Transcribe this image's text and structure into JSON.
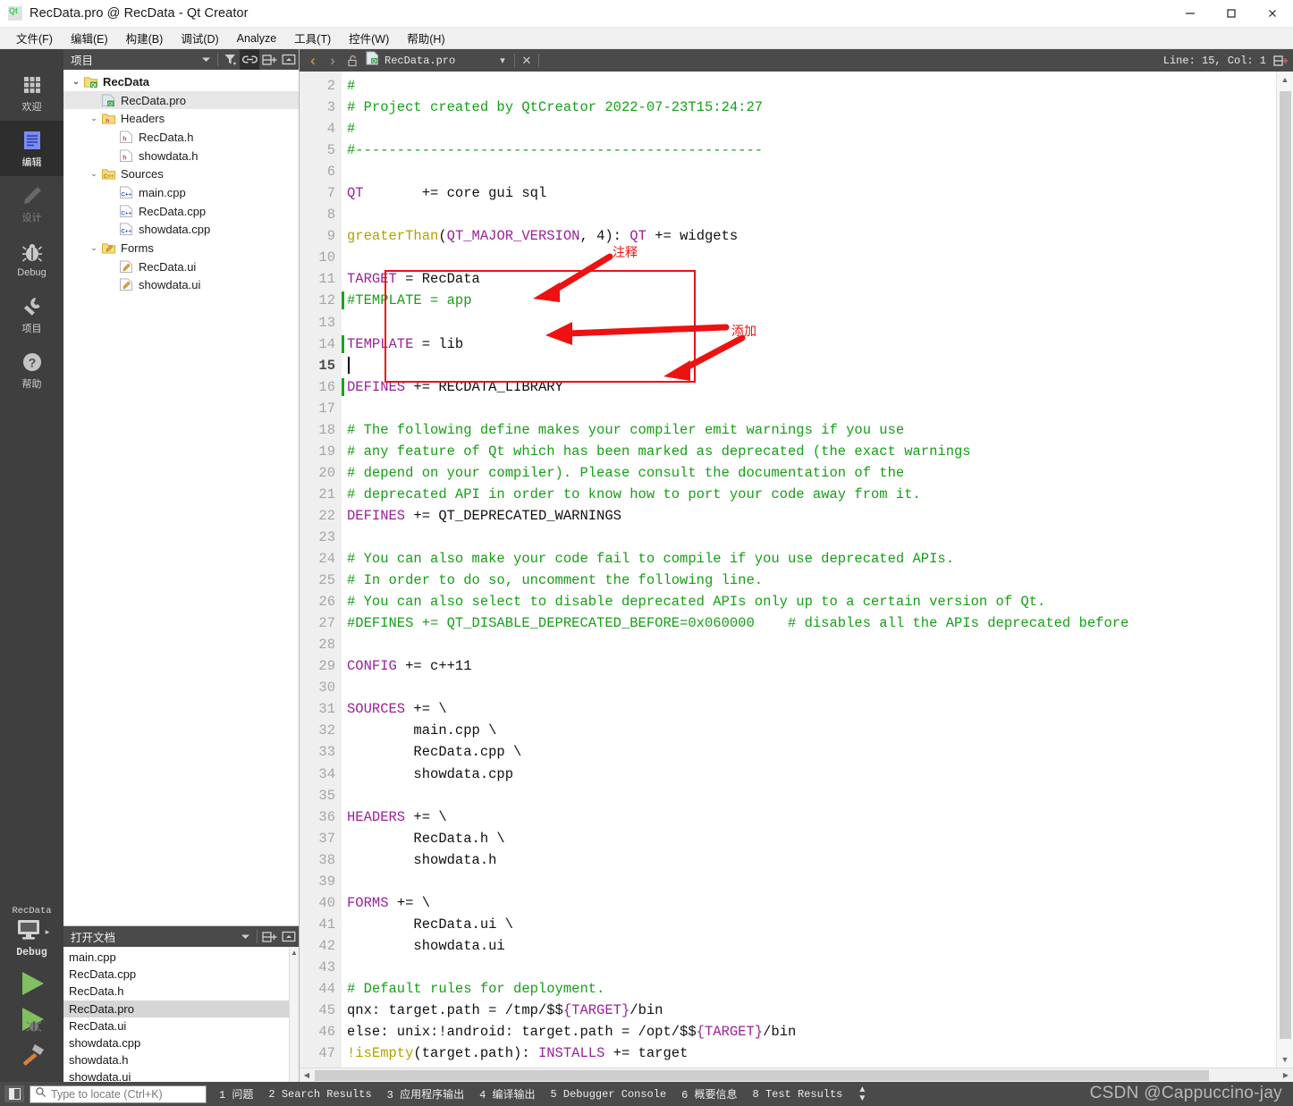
{
  "window": {
    "title": "RecData.pro @ RecData - Qt Creator",
    "app_icon": "qt-logo-icon",
    "minimize": "—",
    "maximize": "□",
    "close": "✕"
  },
  "menubar": {
    "items": [
      {
        "label": "文件(F)",
        "name": "menu-file"
      },
      {
        "label": "编辑(E)",
        "name": "menu-edit"
      },
      {
        "label": "构建(B)",
        "name": "menu-build"
      },
      {
        "label": "调试(D)",
        "name": "menu-debug"
      },
      {
        "label": "Analyze",
        "name": "menu-analyze"
      },
      {
        "label": "工具(T)",
        "name": "menu-tools"
      },
      {
        "label": "控件(W)",
        "name": "menu-window"
      },
      {
        "label": "帮助(H)",
        "name": "menu-help"
      }
    ]
  },
  "modebar": {
    "items": [
      {
        "label": "欢迎",
        "icon": "grid-icon",
        "active": false,
        "disabled": false
      },
      {
        "label": "编辑",
        "icon": "document-lines-icon",
        "active": true,
        "disabled": false
      },
      {
        "label": "设计",
        "icon": "pencil-icon",
        "active": false,
        "disabled": true
      },
      {
        "label": "Debug",
        "icon": "bug-icon",
        "active": false,
        "disabled": false
      },
      {
        "label": "项目",
        "icon": "wrench-icon",
        "active": false,
        "disabled": false
      },
      {
        "label": "帮助",
        "icon": "question-circle-icon",
        "active": false,
        "disabled": false
      }
    ],
    "kit": {
      "project": "RecData",
      "build_config": "Debug",
      "monitor_icon": "monitor-icon",
      "expand_arrow": "▸"
    },
    "run_buttons": [
      {
        "name": "run-button",
        "icon": "play-triangle-icon"
      },
      {
        "name": "start-debugging-button",
        "icon": "play-bug-icon"
      },
      {
        "name": "build-button",
        "icon": "hammer-icon"
      }
    ]
  },
  "project_panel": {
    "title": "项目",
    "tools": [
      {
        "name": "projects-dropdown-icon",
        "glyph": "▾"
      },
      {
        "name": "filter-icon",
        "glyph": "filter"
      },
      {
        "name": "sync-with-editor-icon",
        "glyph": "link",
        "active": true
      },
      {
        "name": "split-icon",
        "glyph": "split"
      },
      {
        "name": "collapse-panel-icon",
        "glyph": "collapse"
      }
    ],
    "tree": [
      {
        "label": "RecData",
        "depth": 0,
        "chevron": "⌄",
        "icon": "qt-project-icon",
        "bold": true,
        "selected": false
      },
      {
        "label": "RecData.pro",
        "depth": 1,
        "chevron": "",
        "icon": "pro-file-icon",
        "bold": false,
        "selected": true
      },
      {
        "label": "Headers",
        "depth": 1,
        "chevron": "⌄",
        "icon": "headers-folder-icon",
        "bold": false,
        "selected": false
      },
      {
        "label": "RecData.h",
        "depth": 2,
        "chevron": "",
        "icon": "h-file-icon",
        "bold": false,
        "selected": false
      },
      {
        "label": "showdata.h",
        "depth": 2,
        "chevron": "",
        "icon": "h-file-icon",
        "bold": false,
        "selected": false
      },
      {
        "label": "Sources",
        "depth": 1,
        "chevron": "⌄",
        "icon": "sources-folder-icon",
        "bold": false,
        "selected": false
      },
      {
        "label": "main.cpp",
        "depth": 2,
        "chevron": "",
        "icon": "cpp-file-icon",
        "bold": false,
        "selected": false
      },
      {
        "label": "RecData.cpp",
        "depth": 2,
        "chevron": "",
        "icon": "cpp-file-icon",
        "bold": false,
        "selected": false
      },
      {
        "label": "showdata.cpp",
        "depth": 2,
        "chevron": "",
        "icon": "cpp-file-icon",
        "bold": false,
        "selected": false
      },
      {
        "label": "Forms",
        "depth": 1,
        "chevron": "⌄",
        "icon": "forms-folder-icon",
        "bold": false,
        "selected": false
      },
      {
        "label": "RecData.ui",
        "depth": 2,
        "chevron": "",
        "icon": "ui-file-icon",
        "bold": false,
        "selected": false
      },
      {
        "label": "showdata.ui",
        "depth": 2,
        "chevron": "",
        "icon": "ui-file-icon",
        "bold": false,
        "selected": false
      }
    ]
  },
  "open_documents": {
    "title": "打开文档",
    "tools": [
      {
        "name": "opendocs-dropdown-icon",
        "glyph": "▾"
      },
      {
        "name": "split-icon",
        "glyph": "split"
      },
      {
        "name": "collapse-panel-icon",
        "glyph": "collapse"
      }
    ],
    "items": [
      {
        "label": "main.cpp",
        "selected": false
      },
      {
        "label": "RecData.cpp",
        "selected": false
      },
      {
        "label": "RecData.h",
        "selected": false
      },
      {
        "label": "RecData.pro",
        "selected": true
      },
      {
        "label": "RecData.ui",
        "selected": false
      },
      {
        "label": "showdata.cpp",
        "selected": false
      },
      {
        "label": "showdata.h",
        "selected": false
      },
      {
        "label": "showdata.ui",
        "selected": false
      }
    ]
  },
  "editor": {
    "nav_back": "‹",
    "nav_forward": "›",
    "lock_icon": "unlocked-icon",
    "tab_name": "RecData.pro",
    "tab_icon": "pro-file-icon",
    "tab_dropdown": "▾",
    "tab_close": "✕",
    "line_col": "Line: 15, Col: 1",
    "split_icon": "split-editor-icon",
    "first_line_number": 2,
    "cursor_line": 15,
    "lines": [
      {
        "n": 2,
        "text": "#",
        "cls": "cmt"
      },
      {
        "n": 3,
        "text": "# Project created by QtCreator 2022-07-23T15:24:27",
        "cls": "cmt"
      },
      {
        "n": 4,
        "text": "#",
        "cls": "cmt"
      },
      {
        "n": 5,
        "text": "#-------------------------------------------------",
        "cls": "cmt"
      },
      {
        "n": 6,
        "text": "",
        "cls": ""
      },
      {
        "n": 7,
        "html": "<span class='kw'>QT</span>       += core gui sql"
      },
      {
        "n": 8,
        "text": "",
        "cls": ""
      },
      {
        "n": 9,
        "html": "<span class='fn'>greaterThan</span>(<span class='kw'>QT_MAJOR_VERSION</span>, 4): <span class='kw'>QT</span> += widgets"
      },
      {
        "n": 10,
        "text": "",
        "cls": ""
      },
      {
        "n": 11,
        "html": "<span class='kw'>TARGET</span> = RecData"
      },
      {
        "n": 12,
        "html": "<span class='cmt'>#TEMPLATE = app</span>",
        "changed": true
      },
      {
        "n": 13,
        "text": "",
        "cls": ""
      },
      {
        "n": 14,
        "html": "<span class='kw'>TEMPLATE</span> = lib",
        "changed": true
      },
      {
        "n": 15,
        "text": "",
        "cls": "",
        "changed": false,
        "cursor": true
      },
      {
        "n": 16,
        "html": "<span class='kw'>DEFINES</span> += RECDATA_LIBRARY",
        "changed": true
      },
      {
        "n": 17,
        "text": "",
        "cls": ""
      },
      {
        "n": 18,
        "text": "# The following define makes your compiler emit warnings if you use",
        "cls": "cmt"
      },
      {
        "n": 19,
        "text": "# any feature of Qt which has been marked as deprecated (the exact warnings",
        "cls": "cmt"
      },
      {
        "n": 20,
        "text": "# depend on your compiler). Please consult the documentation of the",
        "cls": "cmt"
      },
      {
        "n": 21,
        "text": "# deprecated API in order to know how to port your code away from it.",
        "cls": "cmt"
      },
      {
        "n": 22,
        "html": "<span class='kw'>DEFINES</span> += QT_DEPRECATED_WARNINGS"
      },
      {
        "n": 23,
        "text": "",
        "cls": ""
      },
      {
        "n": 24,
        "text": "# You can also make your code fail to compile if you use deprecated APIs.",
        "cls": "cmt"
      },
      {
        "n": 25,
        "text": "# In order to do so, uncomment the following line.",
        "cls": "cmt"
      },
      {
        "n": 26,
        "text": "# You can also select to disable deprecated APIs only up to a certain version of Qt.",
        "cls": "cmt"
      },
      {
        "n": 27,
        "text": "#DEFINES += QT_DISABLE_DEPRECATED_BEFORE=0x060000    # disables all the APIs deprecated before",
        "cls": "cmt"
      },
      {
        "n": 28,
        "text": "",
        "cls": ""
      },
      {
        "n": 29,
        "html": "<span class='kw'>CONFIG</span> += c++11"
      },
      {
        "n": 30,
        "text": "",
        "cls": ""
      },
      {
        "n": 31,
        "html": "<span class='kw'>SOURCES</span> += \\"
      },
      {
        "n": 32,
        "text": "        main.cpp \\",
        "cls": ""
      },
      {
        "n": 33,
        "text": "        RecData.cpp \\",
        "cls": ""
      },
      {
        "n": 34,
        "text": "        showdata.cpp",
        "cls": ""
      },
      {
        "n": 35,
        "text": "",
        "cls": ""
      },
      {
        "n": 36,
        "html": "<span class='kw'>HEADERS</span> += \\"
      },
      {
        "n": 37,
        "text": "        RecData.h \\",
        "cls": ""
      },
      {
        "n": 38,
        "text": "        showdata.h",
        "cls": ""
      },
      {
        "n": 39,
        "text": "",
        "cls": ""
      },
      {
        "n": 40,
        "html": "<span class='kw'>FORMS</span> += \\"
      },
      {
        "n": 41,
        "text": "        RecData.ui \\",
        "cls": ""
      },
      {
        "n": 42,
        "text": "        showdata.ui",
        "cls": ""
      },
      {
        "n": 43,
        "text": "",
        "cls": ""
      },
      {
        "n": 44,
        "text": "# Default rules for deployment.",
        "cls": "cmt"
      },
      {
        "n": 45,
        "html": "qnx: target.path = /tmp/$$<span class='kw'>{TARGET}</span>/bin"
      },
      {
        "n": 46,
        "html": "else: unix:!android: target.path = /opt/$$<span class='kw'>{TARGET}</span>/bin"
      },
      {
        "n": 47,
        "html": "<span class='fn'>!isEmpty</span>(target.path): <span class='kw'>INSTALLS</span> += target"
      }
    ]
  },
  "annotations": {
    "color": "#ee1111",
    "labels": [
      {
        "text": "注释",
        "name": "annotation-label-comment-out"
      },
      {
        "text": "添加",
        "name": "annotation-label-added"
      }
    ]
  },
  "statusbar": {
    "sidebar_toggle_icon": "sidebar-toggle-icon",
    "locator": {
      "placeholder": "Type to locate (Ctrl+K)",
      "value": "",
      "icon": "search-icon"
    },
    "panes": [
      {
        "num": "1",
        "label": "问题"
      },
      {
        "num": "2",
        "label": "Search Results"
      },
      {
        "num": "3",
        "label": "应用程序输出"
      },
      {
        "num": "4",
        "label": "编译输出"
      },
      {
        "num": "5",
        "label": "Debugger Console"
      },
      {
        "num": "6",
        "label": "概要信息"
      },
      {
        "num": "8",
        "label": "Test Results"
      }
    ],
    "updown_icon": "updown-arrows-icon",
    "watermark": "CSDN @Cappuccino-jay"
  }
}
